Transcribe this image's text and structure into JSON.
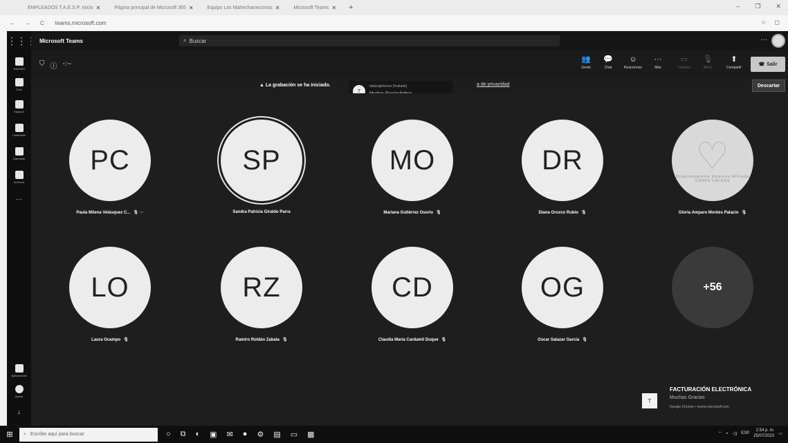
{
  "browser": {
    "tabs": [
      {
        "title": "EMPLEADOS T.A.E.S.P. Inicio"
      },
      {
        "title": "Página principal de Microsoft 365"
      },
      {
        "title": "Equipo Los Mahechamezonos"
      },
      {
        "title": "Microsoft Teams"
      }
    ],
    "url": "teams.microsoft.com"
  },
  "teams": {
    "app_name": "Microsoft Teams",
    "search_placeholder": "Buscar",
    "rail": [
      {
        "label": "Actividad",
        "icon": "bell-icon"
      },
      {
        "label": "Chat",
        "icon": "chat-icon"
      },
      {
        "label": "Equipos",
        "icon": "teams-icon"
      },
      {
        "label": "Calendario",
        "icon": "calendar-icon"
      },
      {
        "label": "Llamadas",
        "icon": "phone-icon"
      },
      {
        "label": "Archivos",
        "icon": "file-icon"
      },
      {
        "label": "···",
        "icon": "more-icon"
      }
    ],
    "rail_bottom": [
      {
        "label": "Aplicaciones",
        "icon": "apps-icon"
      },
      {
        "label": "Ayuda",
        "icon": "help-icon"
      },
      {
        "label": "",
        "icon": "download-icon"
      }
    ],
    "meeting_timer": "-:--",
    "toolbar": [
      {
        "label": "Gente",
        "glyph": "👥"
      },
      {
        "label": "Chat",
        "glyph": "💬"
      },
      {
        "label": "Reacciones",
        "glyph": "☺"
      },
      {
        "label": "Más",
        "glyph": "···"
      },
      {
        "label": "Cámara",
        "glyph": "▭"
      },
      {
        "label": "Micro",
        "glyph": "🎙"
      },
      {
        "label": "Compartir",
        "glyph": "⬆"
      }
    ],
    "leave_label": "Salir",
    "notice": {
      "message": "La grabación se ha iniciado.",
      "privacy_link": "a de privacidad",
      "dismiss_label": "Descartar"
    },
    "chat_toast": {
      "avatar": "T",
      "sender": "tatianajimenez (Invitado)",
      "message": "Muchas Gracias&nbsp;"
    },
    "participants": [
      {
        "initials": "PC",
        "name": "Paula Milena Velásquez C...",
        "speaking": false
      },
      {
        "initials": "SP",
        "name": "Sandra Patricia Giraldo Parra",
        "speaking": true
      },
      {
        "initials": "MO",
        "name": "Mariana Gutiérrez Osorio",
        "speaking": false
      },
      {
        "initials": "DR",
        "name": "Diana Orozco Rubio",
        "speaking": false
      },
      {
        "initials": "",
        "name": "Gloria Amparo Montes Palacio",
        "speaking": false,
        "logo_text": "Orgullosamente Empresa Afiliada",
        "logo_brand": "CONFA CALDAS"
      },
      {
        "initials": "LO",
        "name": "Laura Ocampo",
        "speaking": false
      },
      {
        "initials": "RZ",
        "name": "Ramiro Roldán Zabala",
        "speaking": false
      },
      {
        "initials": "CD",
        "name": "Claudia María Cardamil Duque",
        "speaking": false
      },
      {
        "initials": "OG",
        "name": "Oscar Salazar García",
        "speaking": false
      }
    ],
    "more_count": "+56",
    "share_card": {
      "avatar": "T",
      "title": "FACTURACIÓN ELECTRÓNICA",
      "subtitle": "Muchas Gracias",
      "source": "Google Chrome • teams.microsoft.com"
    }
  },
  "taskbar": {
    "search_placeholder": "Escribe aquí para buscar",
    "language": "ESP",
    "time": "2:54 p. m.",
    "date": "25/07/2022"
  }
}
